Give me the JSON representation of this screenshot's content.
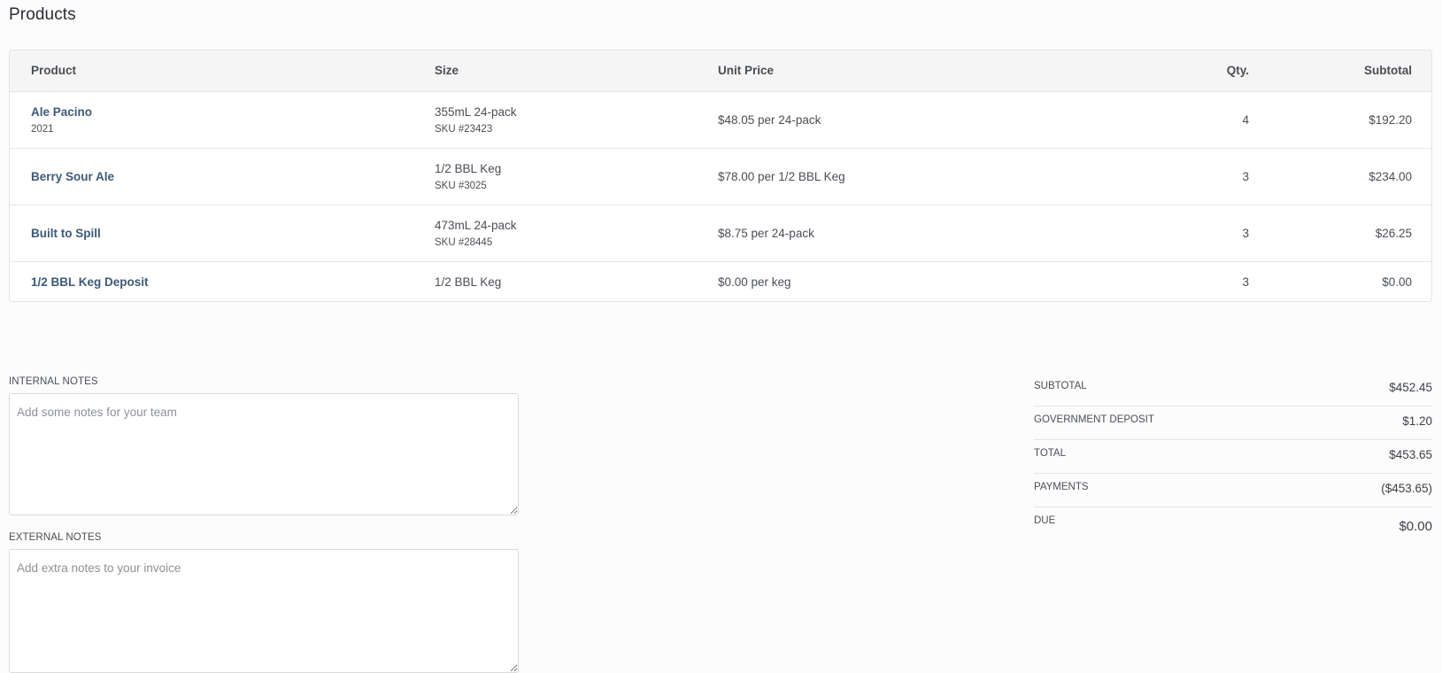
{
  "page": {
    "title": "Products"
  },
  "table": {
    "headers": {
      "product": "Product",
      "size": "Size",
      "unit_price": "Unit Price",
      "qty": "Qty.",
      "subtotal": "Subtotal"
    },
    "rows": [
      {
        "product": "Ale Pacino",
        "product_sub": "2021",
        "size": "355mL 24-pack",
        "sku": "SKU #23423",
        "unit_price": "$48.05 per 24-pack",
        "qty": "4",
        "subtotal": "$192.20"
      },
      {
        "product": "Berry Sour Ale",
        "product_sub": "",
        "size": "1/2 BBL Keg",
        "sku": "SKU #3025",
        "unit_price": "$78.00 per 1/2 BBL Keg",
        "qty": "3",
        "subtotal": "$234.00"
      },
      {
        "product": "Built to Spill",
        "product_sub": "",
        "size": "473mL 24-pack",
        "sku": "SKU #28445",
        "unit_price": "$8.75 per 24-pack",
        "qty": "3",
        "subtotal": "$26.25"
      },
      {
        "product": "1/2 BBL Keg Deposit",
        "product_sub": "",
        "size": "1/2 BBL Keg",
        "sku": "",
        "unit_price": "$0.00 per keg",
        "qty": "3",
        "subtotal": "$0.00"
      }
    ]
  },
  "notes": {
    "internal": {
      "label": "INTERNAL NOTES",
      "placeholder": "Add some notes for your team",
      "value": ""
    },
    "external": {
      "label": "EXTERNAL NOTES",
      "placeholder": "Add extra notes to your invoice",
      "value": ""
    }
  },
  "totals": {
    "subtotal": {
      "label": "SUBTOTAL",
      "value": "$452.45"
    },
    "government_deposit": {
      "label": "GOVERNMENT DEPOSIT",
      "value": "$1.20"
    },
    "total": {
      "label": "TOTAL",
      "value": "$453.65"
    },
    "payments": {
      "label": "PAYMENTS",
      "value": "($453.65)"
    },
    "due": {
      "label": "DUE",
      "value": "$0.00"
    }
  },
  "colors": {
    "product_link": "#3d5a78",
    "header_bg": "#f5f5f5",
    "page_bg": "#fcfcfc"
  }
}
